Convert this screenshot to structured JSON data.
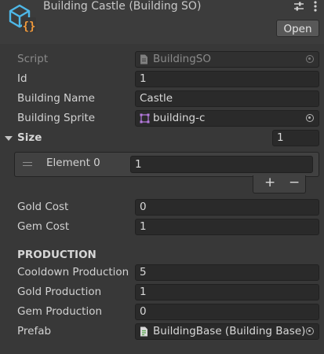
{
  "header": {
    "title": "Building Castle (Building SO)",
    "open_label": "Open",
    "settings_icon": "sliders-icon",
    "menu_icon": "vertical-dots-icon",
    "asset_icon": "scriptable-object-icon"
  },
  "fields": {
    "script": {
      "label": "Script",
      "value": "BuildingSO"
    },
    "id": {
      "label": "Id",
      "value": "1"
    },
    "building_name": {
      "label": "Building Name",
      "value": "Castle"
    },
    "building_sprite": {
      "label": "Building Sprite",
      "value": "building-c"
    },
    "size": {
      "label": "Size",
      "count": "1",
      "elements": [
        {
          "label": "Element 0",
          "value": "1"
        }
      ],
      "add_label": "+",
      "remove_label": "−"
    },
    "gold_cost": {
      "label": "Gold Cost",
      "value": "0"
    },
    "gem_cost": {
      "label": "Gem Cost",
      "value": "1"
    },
    "production_header": "PRODUCTION",
    "cooldown_production": {
      "label": "Cooldown Production",
      "value": "5"
    },
    "gold_production": {
      "label": "Gold Production",
      "value": "1"
    },
    "gem_production": {
      "label": "Gem Production",
      "value": "0"
    },
    "prefab": {
      "label": "Prefab",
      "value": "BuildingBase (Building Base)"
    }
  },
  "colors": {
    "background": "#383838",
    "field_bg": "#2a2a2a",
    "asset_icon_blue": "#4eb8e8",
    "asset_icon_orange": "#f29a3b"
  }
}
